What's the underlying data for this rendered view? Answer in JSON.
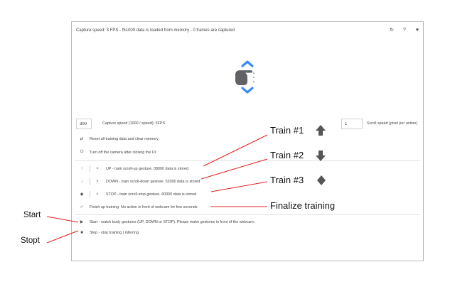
{
  "header": {
    "capture_status": "Capture speed: 3 FPS - f51000 data is loaded from memory - 0 frames are captured",
    "icons": [
      "refresh-icon",
      "help-icon",
      "favorite-icon"
    ],
    "icon_glyphs": [
      "↻",
      "?",
      "♥"
    ]
  },
  "gesture": {
    "hand": "pointing-hand-icon",
    "up": "chevron-up-icon",
    "down": "chevron-down-icon",
    "accent_color": "#3b8ef0"
  },
  "controls": {
    "capture_speed_value": "300",
    "capture_speed_label": "Capture speed (1000 / speed): 3FPS",
    "scroll_speed_value": "1",
    "scroll_speed_label": "Scroll speed (pixel per action)"
  },
  "actions": {
    "reset": "Reset all training data and clear memory",
    "turn_off": "Turn off the camera after closing the UI"
  },
  "training": [
    {
      "text": "UP - train scroll-up gesture. 38000 data is stored"
    },
    {
      "text": "DOWN - train scroll-down gesture. 52000 data is stored"
    },
    {
      "text": "STOP - train scroll-stop gesture. 60000 data is stored"
    }
  ],
  "finish": "Finish up training. No action in front of webcam for few seconds",
  "start": "Start - watch body gestures (UP, DOWN or STOP). Please make gestures in front of the webcam.",
  "stop": "Stop - stop training | inferring",
  "annotations": {
    "train1": "Train #1",
    "train2": "Train #2",
    "train3": "Train #3",
    "finalize": "Finalize training",
    "start": "Start",
    "stop": "Stopt",
    "line_color": "#e02020"
  }
}
